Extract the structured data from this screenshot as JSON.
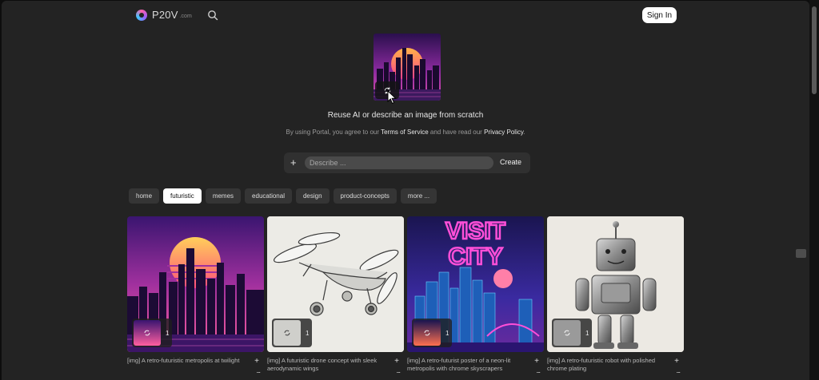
{
  "header": {
    "logo_text": "P20V",
    "logo_sub": ".com",
    "search_icon": "search-icon",
    "signin_label": "Sign In"
  },
  "hero": {
    "title": "Reuse AI or describe an image from scratch",
    "terms_prefix": "By using Portal, you agree to our ",
    "terms_link": "Terms of Service",
    "terms_mid": " and have read our ",
    "privacy_link": "Privacy Policy",
    "terms_suffix": "."
  },
  "prompt": {
    "plus_label": "+",
    "placeholder": "Describe ...",
    "create_label": "Create"
  },
  "tags": [
    {
      "label": "home",
      "active": false
    },
    {
      "label": "futuristic",
      "active": true
    },
    {
      "label": "memes",
      "active": false
    },
    {
      "label": "educational",
      "active": false
    },
    {
      "label": "design",
      "active": false
    },
    {
      "label": "product-concepts",
      "active": false
    },
    {
      "label": "more ...",
      "active": false
    }
  ],
  "cards": [
    {
      "caption": "[img] A retro-futuristic metropolis at twilight",
      "count": "1",
      "plus": "+",
      "more": "..."
    },
    {
      "caption": "[img] A futuristic drone concept with sleek aerodynamic wings",
      "count": "1",
      "plus": "+",
      "more": "..."
    },
    {
      "caption": "[img] A retro-futurist poster of a neon-lit metropolis with chrome skyscrapers",
      "count": "1",
      "plus": "+",
      "more": "...",
      "poster_line1": "VISIT",
      "poster_line2": "CITY"
    },
    {
      "caption": "[img] A retro-futuristic robot with polished chrome plating",
      "count": "1",
      "plus": "+",
      "more": "..."
    }
  ],
  "colors": {
    "background": "#232323",
    "accent_neon": "#ff4fd8",
    "active_tag": "#ffffff"
  }
}
